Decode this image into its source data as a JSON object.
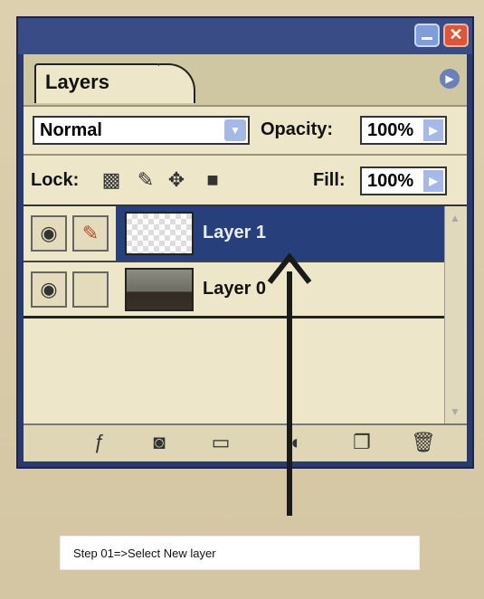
{
  "panel": {
    "tab_label": "Layers",
    "blend_mode": "Normal",
    "opacity_label": "Opacity:",
    "opacity_value": "100%",
    "lock_label": "Lock:",
    "fill_label": "Fill:",
    "fill_value": "100%"
  },
  "layers": [
    {
      "name": "Layer 1",
      "selected": true,
      "thumbnail": "transparent-checkerboard",
      "visible": true
    },
    {
      "name": "Layer 0",
      "selected": false,
      "thumbnail": "photo",
      "visible": true
    }
  ],
  "icons": {
    "minimize": "minimize-icon",
    "close": "close-icon",
    "panel_menu": "panel-menu-arrow-icon",
    "lock_transparent": "lock-transparent-pixels-icon",
    "lock_image": "lock-image-pixels-icon",
    "lock_position": "lock-position-icon",
    "lock_all": "lock-all-icon",
    "visibility": "eye-icon",
    "brush": "brush-icon",
    "bottom": [
      "link-layers-icon",
      "add-layer-style-icon",
      "add-mask-icon",
      "new-folder-icon",
      "adjustment-layer-icon",
      "new-layer-icon",
      "delete-layer-icon"
    ]
  },
  "colors": {
    "title_bar": "#394c86",
    "selection": "#27407c",
    "panel_bg": "#ede6c8",
    "close_button": "#d9573a",
    "arrow": "#1a1a1a"
  },
  "caption": "Step 01=>Select New layer"
}
